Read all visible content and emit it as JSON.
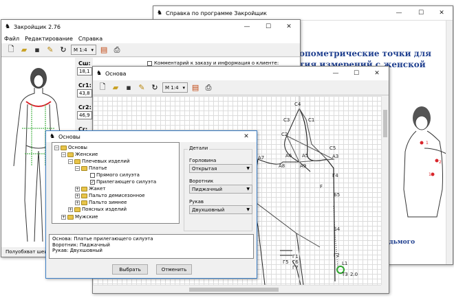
{
  "help_window": {
    "title": "Справка по программе Закройщик",
    "heading_line1": "опометрические точки для",
    "heading_line2": "тия измерений с женской",
    "bottom_text": "ка седьмого"
  },
  "main_window": {
    "title": "Закройщик 2.76",
    "menu": [
      "Файл",
      "Редактирование",
      "Справка"
    ],
    "scale": "М 1:4",
    "fields": [
      {
        "label": "Сш:",
        "value": "18,1"
      },
      {
        "label": "Сг1:",
        "value": "43,8"
      },
      {
        "label": "Сг2:",
        "value": "46,9"
      },
      {
        "label": "Сг:",
        "value": ""
      }
    ],
    "comment_label": "Комментарий к заказу и информация о клиенте:",
    "status_text": "Полуобхват шеи"
  },
  "osnova_window": {
    "title": "Основа",
    "scale": "М 1:4",
    "points": [
      "C4",
      "C3",
      "C1",
      "C2",
      "A6",
      "A5",
      "C5",
      "A3",
      "A7",
      "A8",
      "A9",
      "Г4",
      "F",
      "Б5",
      "Б4",
      "Г1",
      "Г2",
      "Г5",
      "Г6",
      "Г7",
      "L1",
      "T3",
      "2.0"
    ]
  },
  "dialog": {
    "title": "Основы",
    "tree": [
      "Основы",
      "Женские",
      "Плечевых изделий",
      "Платье",
      "Прямого силуэта",
      "Прилегающего силуэта",
      "Жакет",
      "Пальто демисезонное",
      "Пальто зимнее",
      "Поясных изделий",
      "Мужские"
    ],
    "details_title": "Детали",
    "neckline_label": "Горловина",
    "neckline_value": "Открытая",
    "collar_label": "Воротник",
    "collar_value": "Пиджачный",
    "sleeve_label": "Рукав",
    "sleeve_value": "Двухшовный",
    "summary_line1": "Основа: Платье прилегающего силуэта",
    "summary_line2": "Воротник: Пиджачный",
    "summary_line3": "Рукав: Двухшовный",
    "ok_button": "Выбрать",
    "cancel_button": "Отменить"
  },
  "colors": {
    "accent": "#3c7fc6",
    "red": "#d9262c",
    "green": "#2aa52a"
  },
  "icons": [
    "app-icon",
    "new-icon",
    "open-icon",
    "save-icon",
    "brush-icon",
    "undo-icon",
    "scale-icon",
    "print-icon",
    "folder-icon"
  ]
}
